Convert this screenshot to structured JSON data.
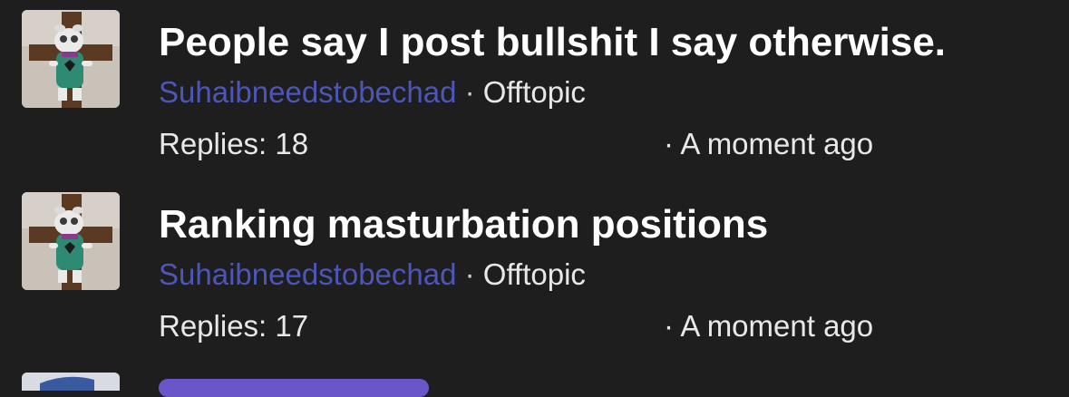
{
  "threads": [
    {
      "title": "People say I post bullshit I say otherwise.",
      "author": "Suhaibneedstobechad",
      "separator": "·",
      "category": "Offtopic",
      "replies": "Replies: 18",
      "time": "· A moment ago",
      "avatar_icon": "plush-on-cross-avatar-icon"
    },
    {
      "title": "Ranking masturbation positions",
      "author": "Suhaibneedstobechad",
      "separator": "·",
      "category": "Offtopic",
      "replies": "Replies: 17",
      "time": "· A moment ago",
      "avatar_icon": "plush-on-cross-avatar-icon"
    }
  ],
  "colors": {
    "background": "#1e1e1f",
    "author_link": "#4e55b8",
    "title": "#ffffff",
    "meta_text": "#e8e8e8",
    "partial_pill": "#6a55c9"
  }
}
